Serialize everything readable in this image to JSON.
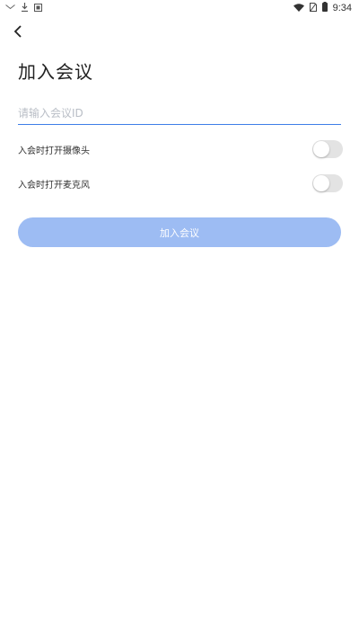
{
  "status_bar": {
    "time": "9:34",
    "icons": [
      "mail-icon",
      "download-icon",
      "notification-icon",
      "wifi-icon",
      "no-sim-icon",
      "battery-icon"
    ]
  },
  "header": {
    "back_icon": "chevron-left-icon",
    "title": "加入会议"
  },
  "form": {
    "meeting_id_placeholder": "请输入会议ID",
    "meeting_id_value": "",
    "options": [
      {
        "label": "入会时打开摄像头",
        "enabled": false
      },
      {
        "label": "入会时打开麦克风",
        "enabled": false
      }
    ],
    "join_label": "加入会议"
  },
  "colors": {
    "accent": "#3f7ee8",
    "button_disabled": "#9dbcf3",
    "toggle_off": "#e3e3e3"
  }
}
